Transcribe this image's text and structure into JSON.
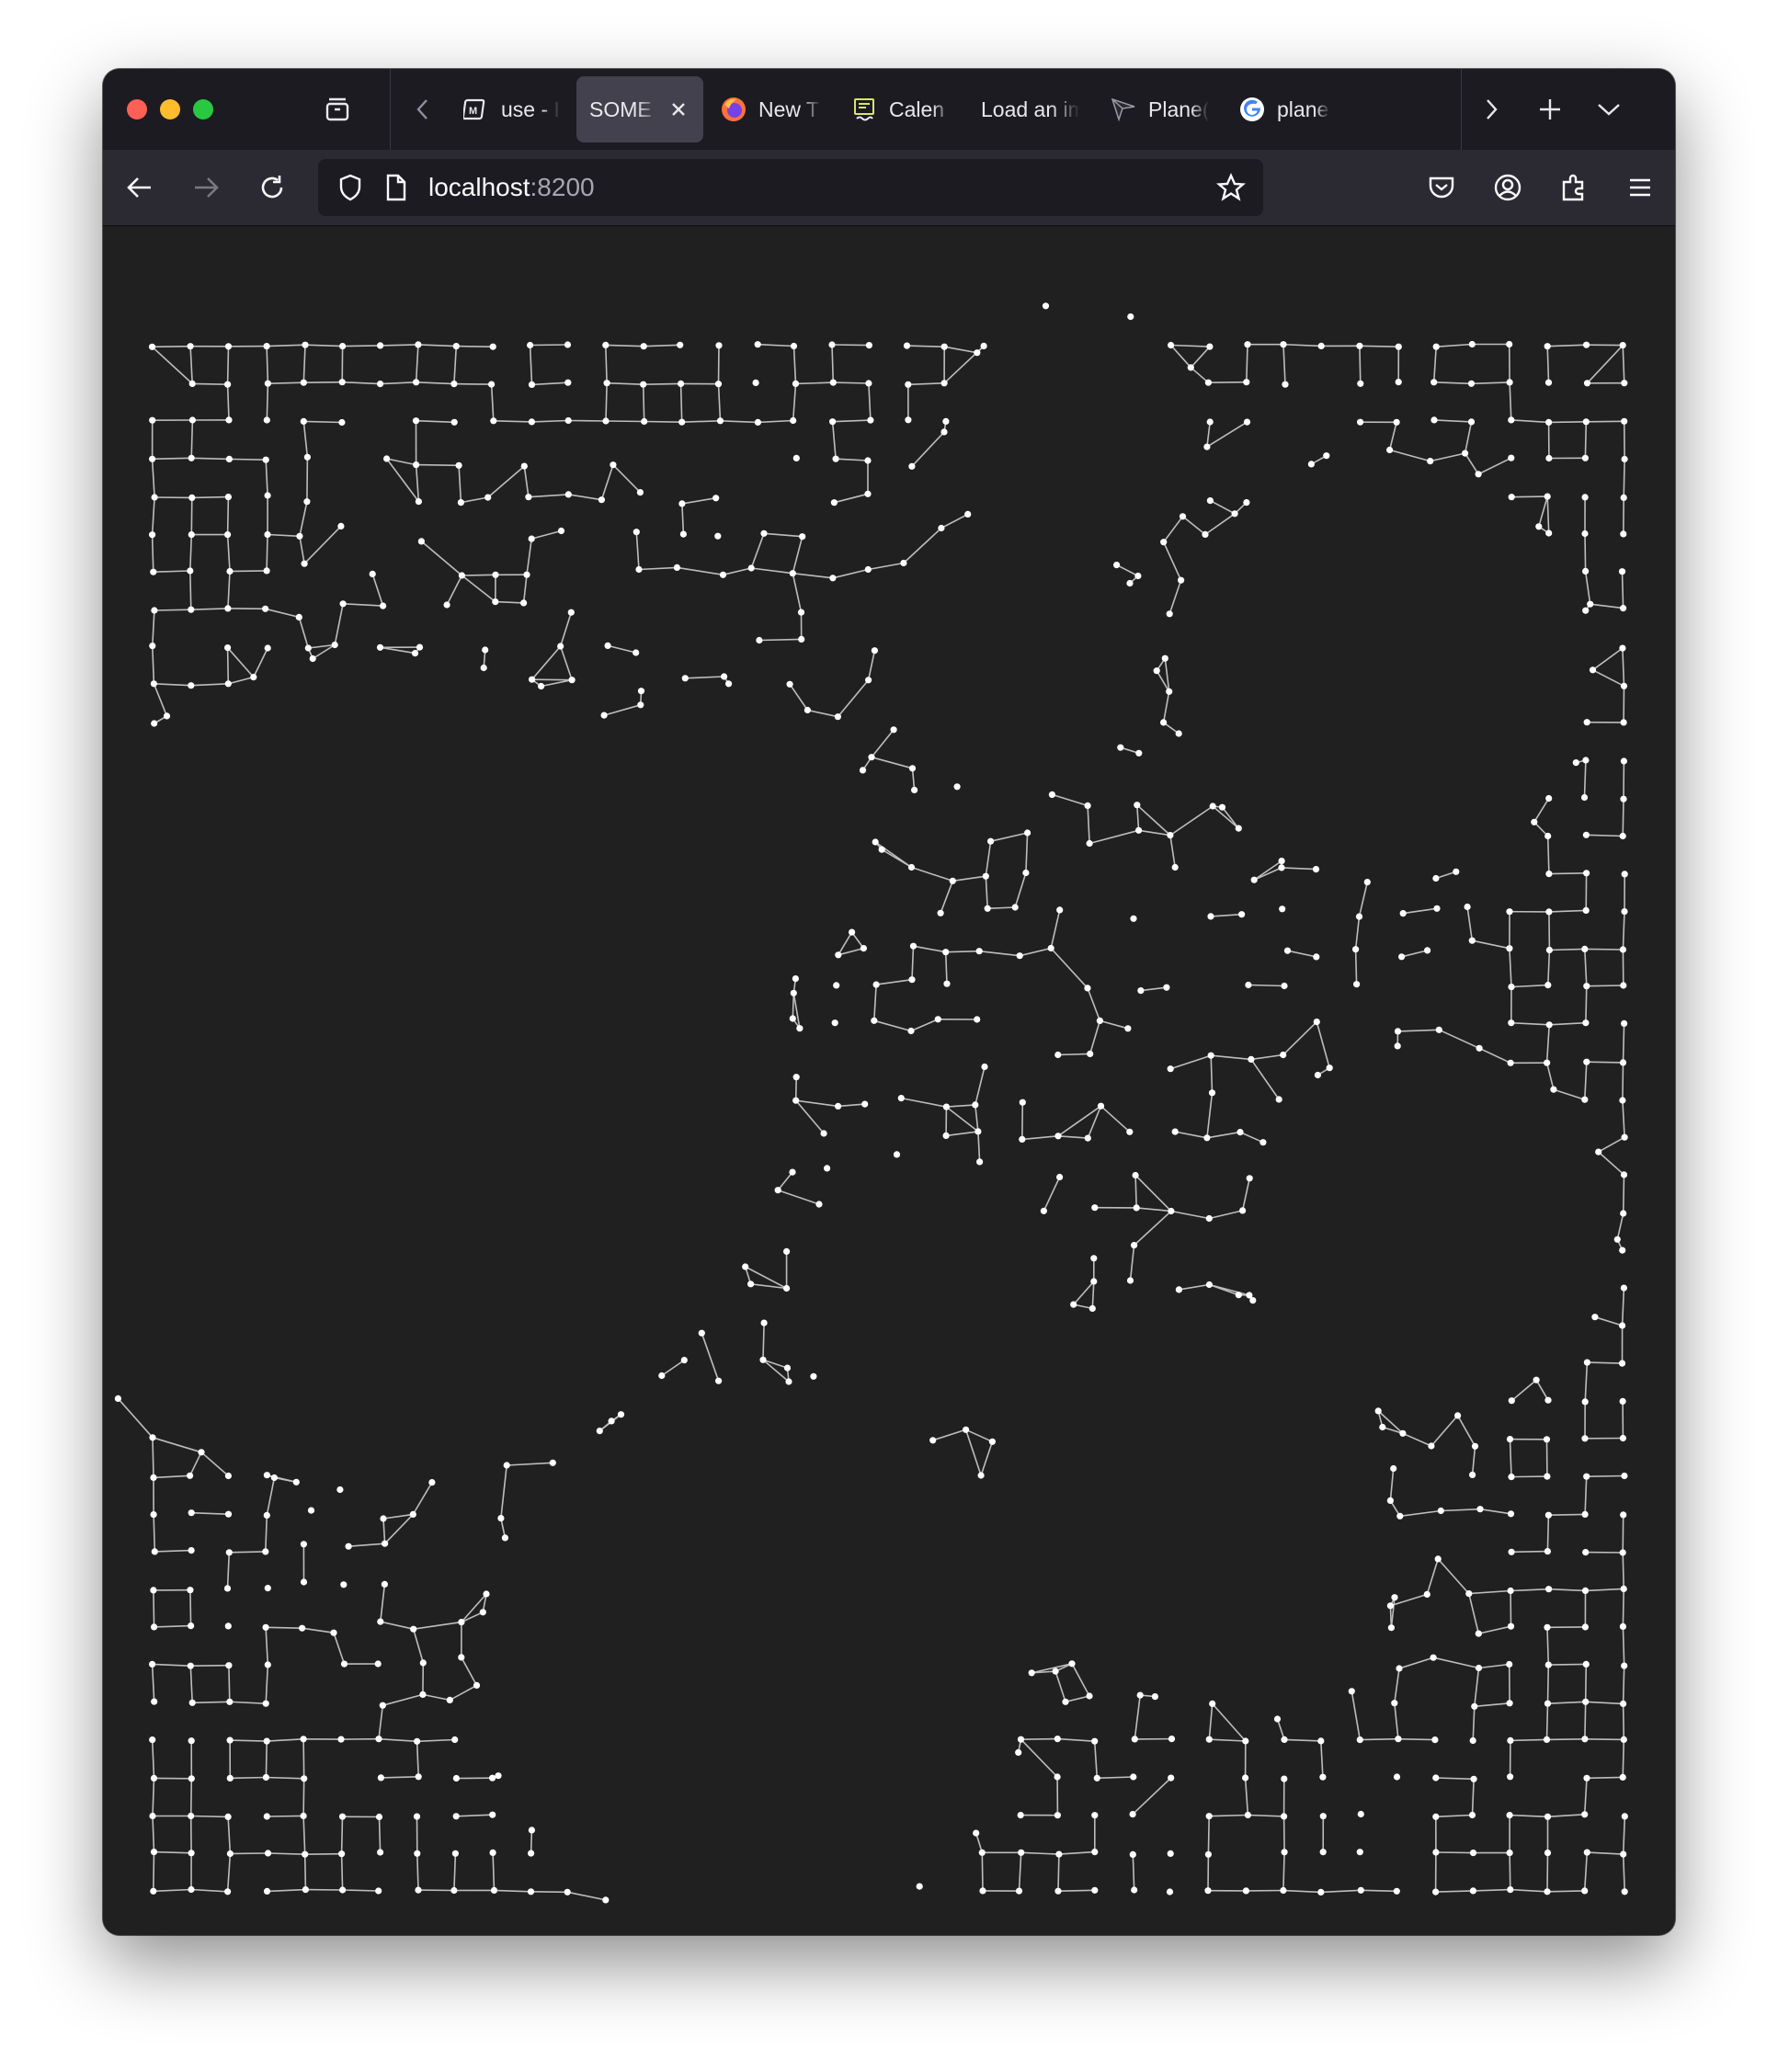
{
  "browser": {
    "tabs": [
      {
        "label": "use - I",
        "favicon": "markdown-icon",
        "active": false
      },
      {
        "label": "SOME C",
        "favicon": "",
        "active": true
      },
      {
        "label": "New T",
        "favicon": "firefox-icon",
        "active": false
      },
      {
        "label": "Calen",
        "favicon": "calendar-app-icon",
        "active": false
      },
      {
        "label": "Load an im",
        "favicon": "",
        "active": false
      },
      {
        "label": "Plane(",
        "favicon": "plane-icon",
        "active": false
      },
      {
        "label": "plane",
        "favicon": "google-icon",
        "active": false
      }
    ],
    "url": {
      "host": "localhost",
      "port": ":8200"
    }
  },
  "page": {
    "description_colors": {
      "background": "#202020",
      "node": "#ffffff",
      "edge": "#bdbdbd"
    }
  }
}
